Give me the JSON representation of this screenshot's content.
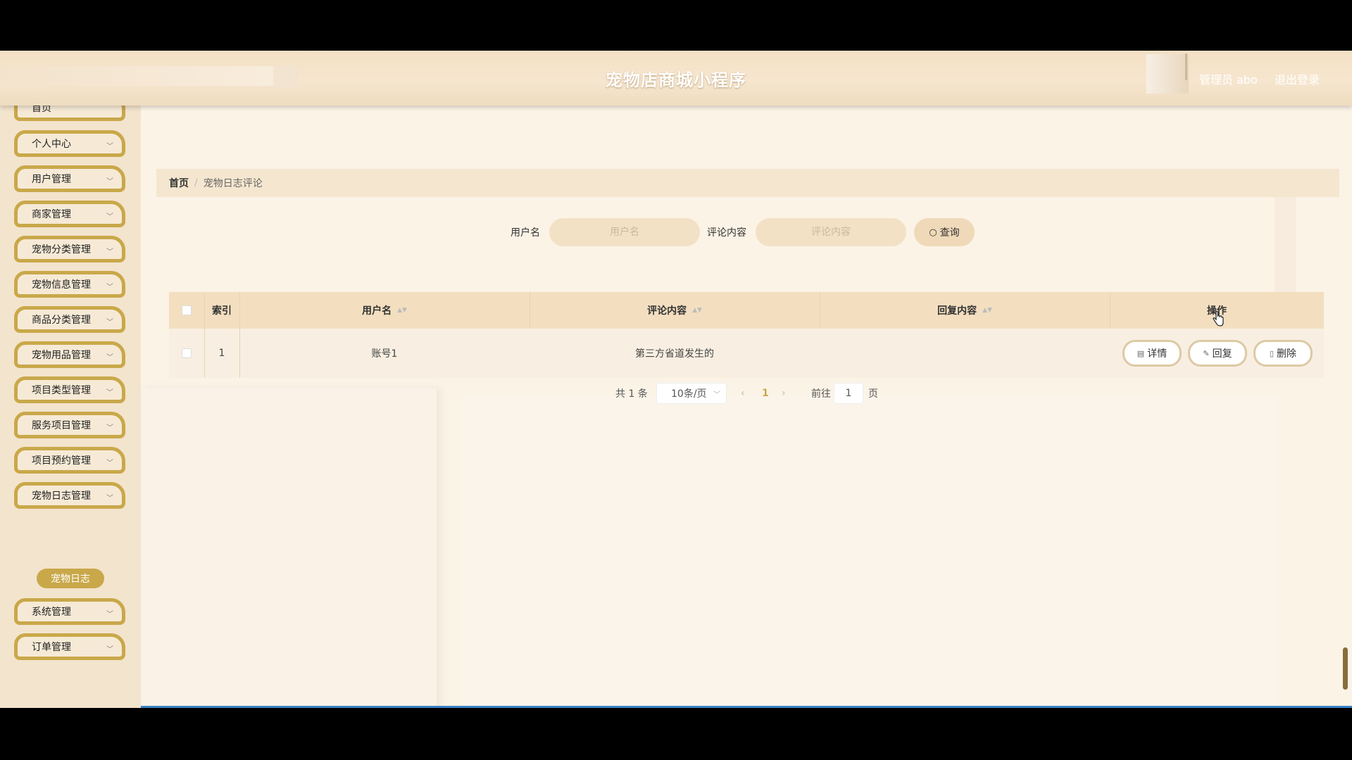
{
  "header": {
    "title": "宠物店商城小程序",
    "admin_label": "管理员 abo",
    "logout_label": "退出登录"
  },
  "sidebar": {
    "top_partial_label": "首页",
    "items": [
      {
        "label": "个人中心"
      },
      {
        "label": "用户管理"
      },
      {
        "label": "商家管理"
      },
      {
        "label": "宠物分类管理"
      },
      {
        "label": "宠物信息管理"
      },
      {
        "label": "商品分类管理"
      },
      {
        "label": "宠物用品管理"
      },
      {
        "label": "项目类型管理"
      },
      {
        "label": "服务项目管理"
      },
      {
        "label": "项目预约管理"
      },
      {
        "label": "宠物日志管理"
      },
      {
        "label": "系统管理"
      },
      {
        "label": "订单管理"
      }
    ],
    "active_sub_item": "宠物日志"
  },
  "breadcrumb": {
    "home": "首页",
    "separator": "/",
    "current": "宠物日志评论"
  },
  "search": {
    "username_label": "用户名",
    "username_placeholder": "用户名",
    "content_label": "评论内容",
    "content_placeholder": "评论内容",
    "query_button": "查询"
  },
  "table": {
    "columns": {
      "index": "索引",
      "username": "用户名",
      "comment": "评论内容",
      "reply": "回复内容",
      "actions": "操作"
    },
    "rows": [
      {
        "index": "1",
        "username": "账号1",
        "comment": "第三方省道发生的",
        "reply": ""
      }
    ],
    "actions": {
      "detail": "详情",
      "reply": "回复",
      "delete": "删除"
    }
  },
  "pagination": {
    "total_text": "共 1 条",
    "page_size": "10条/页",
    "current_page": "1",
    "goto_label": "前往",
    "goto_value": "1",
    "page_suffix": "页"
  }
}
